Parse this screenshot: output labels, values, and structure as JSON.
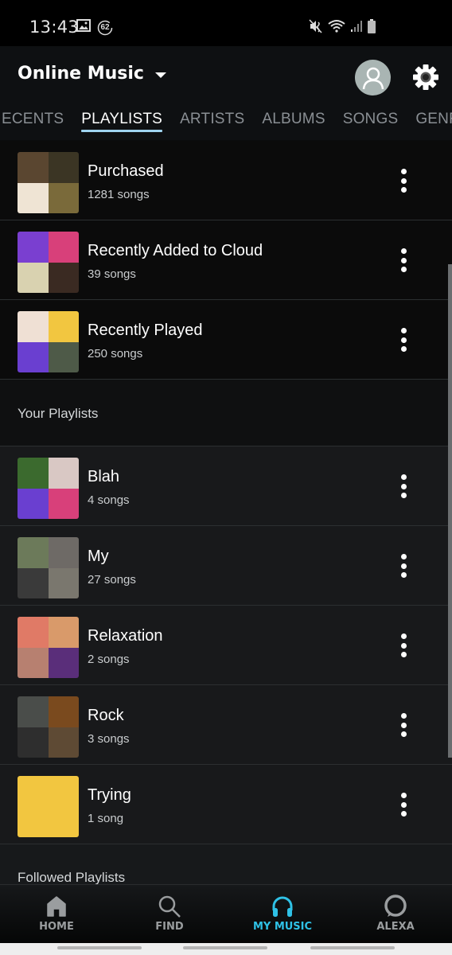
{
  "status_bar": {
    "time": "13:43",
    "notification_badge": "62",
    "icons_left": [
      "gallery-icon",
      "data-saver-badge-icon"
    ],
    "icons_right": [
      "mute-vibrate-icon",
      "wifi-icon",
      "signal-icon",
      "battery-icon"
    ]
  },
  "header": {
    "title": "Online Music",
    "dropdown_icon": "caret-down-icon",
    "profile_icon": "avatar-icon",
    "settings_icon": "gear-icon"
  },
  "tabs": [
    {
      "label": "RECENTS",
      "visible_text": "ECENTS",
      "active": false
    },
    {
      "label": "PLAYLISTS",
      "visible_text": "PLAYLISTS",
      "active": true
    },
    {
      "label": "ARTISTS",
      "visible_text": "ARTISTS",
      "active": false
    },
    {
      "label": "ALBUMS",
      "visible_text": "ALBUMS",
      "active": false
    },
    {
      "label": "SONGS",
      "visible_text": "SONGS",
      "active": false
    },
    {
      "label": "GENRES",
      "visible_text": "GENRES",
      "active": false
    }
  ],
  "smart_playlists": [
    {
      "title": "Purchased",
      "subtitle": "1281 songs",
      "art": [
        "#5a4630",
        "#3b3524",
        "#efe4d4",
        "#7a6a3a"
      ]
    },
    {
      "title": "Recently Added to Cloud",
      "subtitle": "39 songs",
      "art": [
        "#7a3fd0",
        "#d8407a",
        "#d9d2b0",
        "#3a2a22"
      ]
    },
    {
      "title": "Recently Played",
      "subtitle": "250 songs",
      "art": [
        "#efe0d4",
        "#f2c640",
        "#6a3fd0",
        "#4e5a48"
      ]
    }
  ],
  "your_playlists_heading": "Your Playlists",
  "your_playlists": [
    {
      "title": "Blah",
      "subtitle": "4 songs",
      "art": [
        "#3b6a2e",
        "#d9c8c4",
        "#6a3fd0",
        "#d8407a"
      ]
    },
    {
      "title": "My",
      "subtitle": "27 songs",
      "art": [
        "#6c7a5a",
        "#6e6a66",
        "#3a3a3a",
        "#7a776e"
      ]
    },
    {
      "title": "Relaxation",
      "subtitle": "2 songs",
      "art": [
        "#e07a66",
        "#d99a6a",
        "#b78070",
        "#5a2e7a"
      ]
    },
    {
      "title": "Rock",
      "subtitle": "3 songs",
      "art": [
        "#4a4d4a",
        "#7a4a1e",
        "#2e2e2e",
        "#5e4a34"
      ]
    },
    {
      "title": "Trying",
      "subtitle": "1 song",
      "art": [
        "#f2c640"
      ]
    }
  ],
  "followed_playlists_heading": "Followed Playlists",
  "bottom_nav": [
    {
      "label": "HOME",
      "icon": "home-icon",
      "active": false
    },
    {
      "label": "FIND",
      "icon": "search-icon",
      "active": false
    },
    {
      "label": "MY MUSIC",
      "icon": "headphones-icon",
      "active": true
    },
    {
      "label": "ALEXA",
      "icon": "alexa-ring-icon",
      "active": false
    }
  ],
  "colors": {
    "accent": "#2fc1e6",
    "tab_underline": "#9fd4f0",
    "background": "#0b0c0d"
  }
}
